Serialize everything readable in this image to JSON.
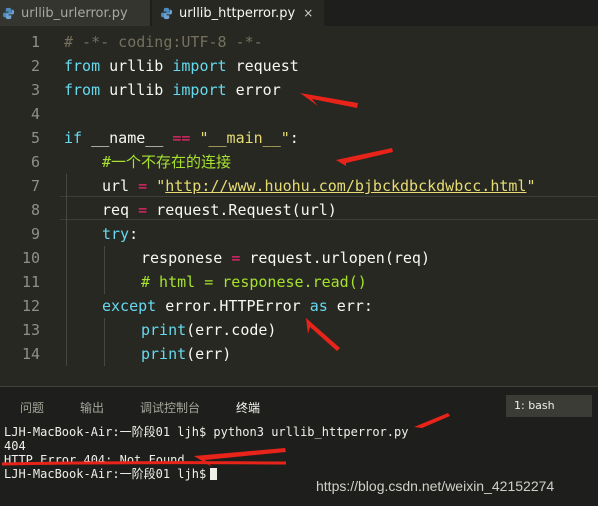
{
  "tabs": [
    {
      "label": "urllib_urlerror.py",
      "active": false
    },
    {
      "label": "urllib_httperror.py",
      "active": true,
      "close": "×"
    }
  ],
  "editor": {
    "line_numbers": [
      "1",
      "2",
      "3",
      "4",
      "5",
      "6",
      "7",
      "8",
      "9",
      "10",
      "11",
      "12",
      "13",
      "14"
    ],
    "code": {
      "l1": "# -*- coding:UTF-8 -*-",
      "l2_kw1": "from",
      "l2_mod": " urllib ",
      "l2_kw2": "import",
      "l2_name": " request",
      "l3_kw1": "from",
      "l3_mod": " urllib ",
      "l3_kw2": "import",
      "l3_name": " error",
      "l5_kw": "if",
      "l5_a": " __name__ ",
      "l5_op": "==",
      "l5_sp": " ",
      "l5_str": "\"__main__\"",
      "l5_colon": ":",
      "l6": "#一个不存在的连接",
      "l7_a": "url ",
      "l7_op": "=",
      "l7_sp": " ",
      "l7_q1": "\"",
      "l7_url": "http://www.huohu.com/bjbckdbckdwbcc.html",
      "l7_q2": "\"",
      "l8_a": "req ",
      "l8_op": "=",
      "l8_b": " request.Request(url)",
      "l9_kw": "try",
      "l9_b": ":",
      "l10_a": "responese ",
      "l10_op": "=",
      "l10_b": " request.urlopen(req)",
      "l11": "# html = responese.read()",
      "l12_kw1": "except",
      "l12_a": " error.HTTPError ",
      "l12_kw2": "as",
      "l12_b": " err:",
      "l13_kw": "print",
      "l13_b": "(err.code)",
      "l14_kw": "print",
      "l14_b": "(err)"
    }
  },
  "panel": {
    "tabs": [
      "问题",
      "输出",
      "调试控制台",
      "终端"
    ],
    "active_tab": "终端",
    "terminal_select": "1: bash",
    "terminal_lines": [
      "LJH-MacBook-Air:一阶段01 ljh$ python3 urllib_httperror.py",
      "404",
      "HTTP Error 404: Not Found",
      "LJH-MacBook-Air:一阶段01 ljh$"
    ]
  },
  "watermark": "https://blog.csdn.net/weixin_42152274",
  "colors": {
    "arrow": "#e8231a",
    "python_icon": "#4b8bbe",
    "keyword": "#66d9ef",
    "string": "#e6db74",
    "comment": "#75715e"
  }
}
